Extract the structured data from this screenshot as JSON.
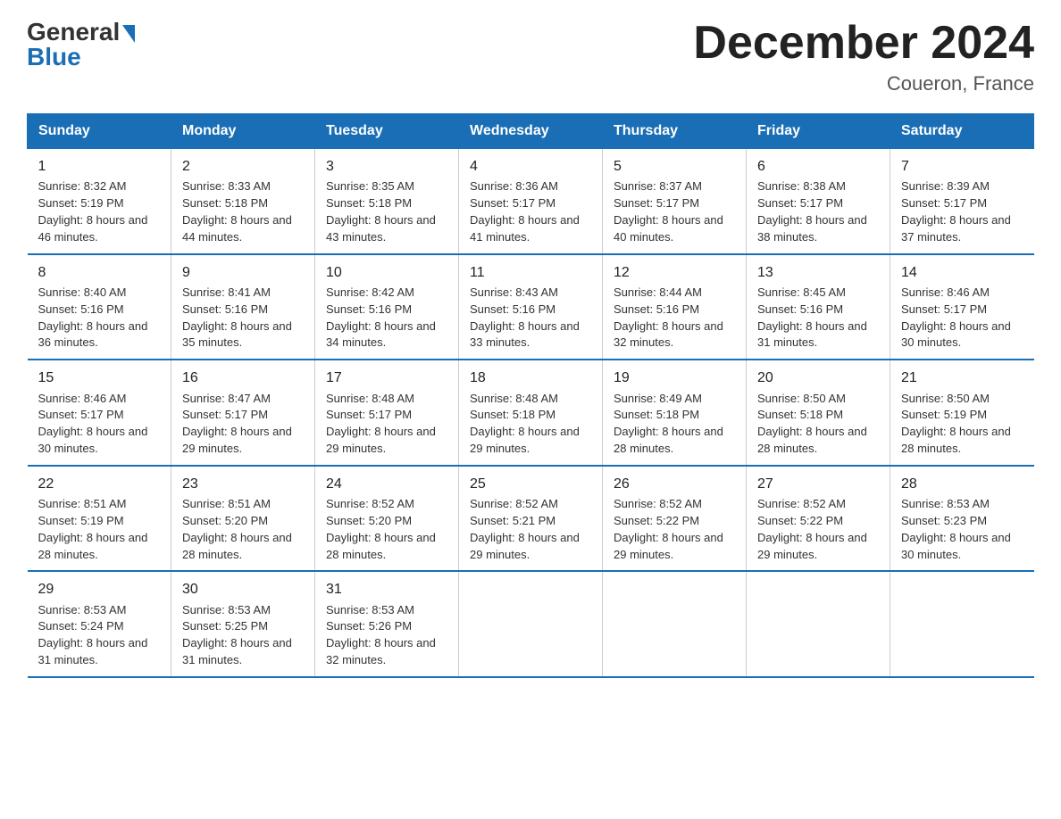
{
  "logo": {
    "line1": "General",
    "line2": "Blue"
  },
  "title": "December 2024",
  "location": "Coueron, France",
  "days_header": [
    "Sunday",
    "Monday",
    "Tuesday",
    "Wednesday",
    "Thursday",
    "Friday",
    "Saturday"
  ],
  "weeks": [
    [
      {
        "day": "1",
        "sunrise": "8:32 AM",
        "sunset": "5:19 PM",
        "daylight": "8 hours and 46 minutes."
      },
      {
        "day": "2",
        "sunrise": "8:33 AM",
        "sunset": "5:18 PM",
        "daylight": "8 hours and 44 minutes."
      },
      {
        "day": "3",
        "sunrise": "8:35 AM",
        "sunset": "5:18 PM",
        "daylight": "8 hours and 43 minutes."
      },
      {
        "day": "4",
        "sunrise": "8:36 AM",
        "sunset": "5:17 PM",
        "daylight": "8 hours and 41 minutes."
      },
      {
        "day": "5",
        "sunrise": "8:37 AM",
        "sunset": "5:17 PM",
        "daylight": "8 hours and 40 minutes."
      },
      {
        "day": "6",
        "sunrise": "8:38 AM",
        "sunset": "5:17 PM",
        "daylight": "8 hours and 38 minutes."
      },
      {
        "day": "7",
        "sunrise": "8:39 AM",
        "sunset": "5:17 PM",
        "daylight": "8 hours and 37 minutes."
      }
    ],
    [
      {
        "day": "8",
        "sunrise": "8:40 AM",
        "sunset": "5:16 PM",
        "daylight": "8 hours and 36 minutes."
      },
      {
        "day": "9",
        "sunrise": "8:41 AM",
        "sunset": "5:16 PM",
        "daylight": "8 hours and 35 minutes."
      },
      {
        "day": "10",
        "sunrise": "8:42 AM",
        "sunset": "5:16 PM",
        "daylight": "8 hours and 34 minutes."
      },
      {
        "day": "11",
        "sunrise": "8:43 AM",
        "sunset": "5:16 PM",
        "daylight": "8 hours and 33 minutes."
      },
      {
        "day": "12",
        "sunrise": "8:44 AM",
        "sunset": "5:16 PM",
        "daylight": "8 hours and 32 minutes."
      },
      {
        "day": "13",
        "sunrise": "8:45 AM",
        "sunset": "5:16 PM",
        "daylight": "8 hours and 31 minutes."
      },
      {
        "day": "14",
        "sunrise": "8:46 AM",
        "sunset": "5:17 PM",
        "daylight": "8 hours and 30 minutes."
      }
    ],
    [
      {
        "day": "15",
        "sunrise": "8:46 AM",
        "sunset": "5:17 PM",
        "daylight": "8 hours and 30 minutes."
      },
      {
        "day": "16",
        "sunrise": "8:47 AM",
        "sunset": "5:17 PM",
        "daylight": "8 hours and 29 minutes."
      },
      {
        "day": "17",
        "sunrise": "8:48 AM",
        "sunset": "5:17 PM",
        "daylight": "8 hours and 29 minutes."
      },
      {
        "day": "18",
        "sunrise": "8:48 AM",
        "sunset": "5:18 PM",
        "daylight": "8 hours and 29 minutes."
      },
      {
        "day": "19",
        "sunrise": "8:49 AM",
        "sunset": "5:18 PM",
        "daylight": "8 hours and 28 minutes."
      },
      {
        "day": "20",
        "sunrise": "8:50 AM",
        "sunset": "5:18 PM",
        "daylight": "8 hours and 28 minutes."
      },
      {
        "day": "21",
        "sunrise": "8:50 AM",
        "sunset": "5:19 PM",
        "daylight": "8 hours and 28 minutes."
      }
    ],
    [
      {
        "day": "22",
        "sunrise": "8:51 AM",
        "sunset": "5:19 PM",
        "daylight": "8 hours and 28 minutes."
      },
      {
        "day": "23",
        "sunrise": "8:51 AM",
        "sunset": "5:20 PM",
        "daylight": "8 hours and 28 minutes."
      },
      {
        "day": "24",
        "sunrise": "8:52 AM",
        "sunset": "5:20 PM",
        "daylight": "8 hours and 28 minutes."
      },
      {
        "day": "25",
        "sunrise": "8:52 AM",
        "sunset": "5:21 PM",
        "daylight": "8 hours and 29 minutes."
      },
      {
        "day": "26",
        "sunrise": "8:52 AM",
        "sunset": "5:22 PM",
        "daylight": "8 hours and 29 minutes."
      },
      {
        "day": "27",
        "sunrise": "8:52 AM",
        "sunset": "5:22 PM",
        "daylight": "8 hours and 29 minutes."
      },
      {
        "day": "28",
        "sunrise": "8:53 AM",
        "sunset": "5:23 PM",
        "daylight": "8 hours and 30 minutes."
      }
    ],
    [
      {
        "day": "29",
        "sunrise": "8:53 AM",
        "sunset": "5:24 PM",
        "daylight": "8 hours and 31 minutes."
      },
      {
        "day": "30",
        "sunrise": "8:53 AM",
        "sunset": "5:25 PM",
        "daylight": "8 hours and 31 minutes."
      },
      {
        "day": "31",
        "sunrise": "8:53 AM",
        "sunset": "5:26 PM",
        "daylight": "8 hours and 32 minutes."
      },
      {
        "day": "",
        "sunrise": "",
        "sunset": "",
        "daylight": ""
      },
      {
        "day": "",
        "sunrise": "",
        "sunset": "",
        "daylight": ""
      },
      {
        "day": "",
        "sunrise": "",
        "sunset": "",
        "daylight": ""
      },
      {
        "day": "",
        "sunrise": "",
        "sunset": "",
        "daylight": ""
      }
    ]
  ],
  "labels": {
    "sunrise_prefix": "Sunrise: ",
    "sunset_prefix": "Sunset: ",
    "daylight_prefix": "Daylight: "
  }
}
